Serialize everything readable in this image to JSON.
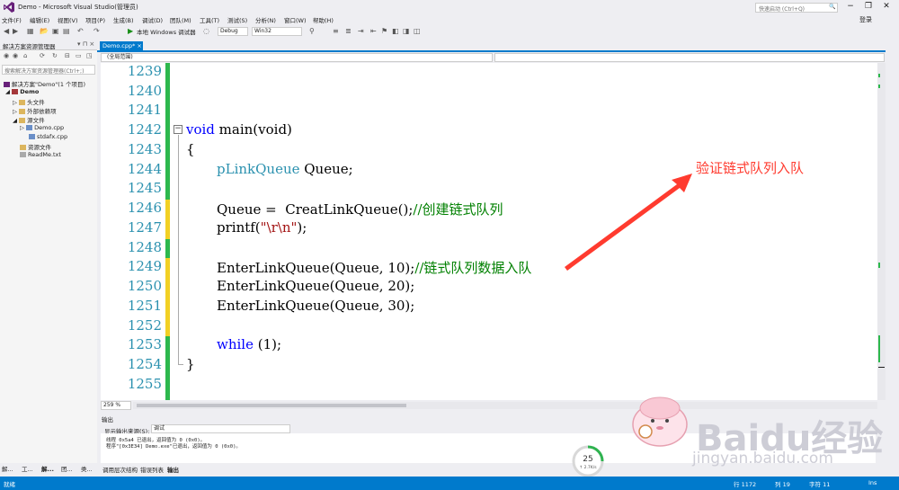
{
  "window": {
    "title": "Demo - Microsoft Visual Studio(管理员)",
    "quick_launch_placeholder": "快速启动 (Ctrl+Q)",
    "login": "登录"
  },
  "menu": [
    "文件(F)",
    "编辑(E)",
    "视图(V)",
    "项目(P)",
    "生成(B)",
    "调试(D)",
    "团队(M)",
    "工具(T)",
    "测试(S)",
    "分析(N)",
    "窗口(W)",
    "帮助(H)"
  ],
  "toolbar": {
    "run_label": "本地 Windows 调试器",
    "config": "Debug",
    "platform": "Win32"
  },
  "solution_explorer": {
    "title": "解决方案资源管理器",
    "search_placeholder": "搜索解决方案资源管理器(Ctrl+;)",
    "items": [
      {
        "label": "解决方案\"Demo\"(1 个项目)"
      },
      {
        "label": "Demo"
      },
      {
        "label": "头文件"
      },
      {
        "label": "外部依赖项"
      },
      {
        "label": "源文件"
      },
      {
        "label": "Demo.cpp"
      },
      {
        "label": "stdafx.cpp"
      },
      {
        "label": "资源文件"
      },
      {
        "label": "ReadMe.txt"
      }
    ],
    "bottom_tabs": [
      "解...",
      "工...",
      "解...",
      "团...",
      "类..."
    ]
  },
  "editor": {
    "tab": "Demo.cpp*",
    "scope": "(全局范围)",
    "zoom": "259 %",
    "line_numbers": [
      "1239",
      "1240",
      "1241",
      "1242",
      "1243",
      "1244",
      "1245",
      "1246",
      "1247",
      "1248",
      "1249",
      "1250",
      "1251",
      "1252",
      "1253",
      "1254",
      "1255"
    ],
    "code": {
      "l1242_kw": "void",
      "l1242_rest": " main(void)",
      "l1243": "{",
      "l1244_ty": "pLinkQueue",
      "l1244_rest": " Queue;",
      "l1246_code": "Queue =  CreatLinkQueue();",
      "l1246_cm": "//创建链式队列",
      "l1247_a": "printf(",
      "l1247_str": "\"\\r\\n\"",
      "l1247_b": ");",
      "l1249_code": "EnterLinkQueue(Queue, 10);",
      "l1249_cm": "//链式队列数据入队",
      "l1250": "EnterLinkQueue(Queue, 20);",
      "l1251": "EnterLinkQueue(Queue, 30);",
      "l1253_kw": "while",
      "l1253_rest": " (1);",
      "l1254": "}"
    },
    "annotation": "验证链式队列入队"
  },
  "output": {
    "title": "输出",
    "source_label": "显示输出来源(S):",
    "source_value": "调试",
    "lines": [
      "线程 0x5a4 已退出，返回值为 0 (0x0)。",
      "程序\"[0x3E34] Demo.exe\"已退出，返回值为 0 (0x0)。"
    ],
    "tabs": [
      "调用层次结构",
      "错误列表",
      "输出"
    ]
  },
  "progress": {
    "value": "25",
    "percent": 25,
    "speed": "↑ 2.7K/s"
  },
  "watermark": {
    "brand": "Baidu经验",
    "url": "jingyan.baidu.com"
  },
  "status": {
    "ready": "就绪",
    "line": "行 1172",
    "col": "列 19",
    "char": "字符 11",
    "mode": "Ins"
  },
  "colors": {
    "accent": "#007acc",
    "keyword": "#0000ff",
    "type": "#2b91af",
    "comment": "#008000",
    "annotation": "#ff3b2f"
  }
}
